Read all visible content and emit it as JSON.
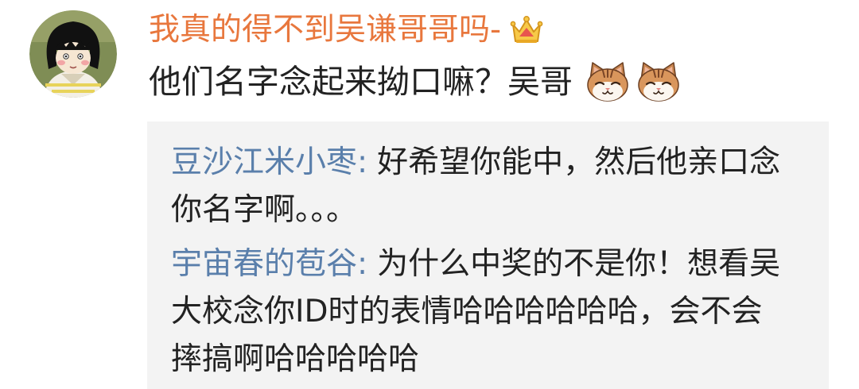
{
  "comment": {
    "avatar_icon": "cartoon-girl-avatar",
    "username": "我真的得不到吴谦哥哥吗-",
    "badge_icon": "crown-icon",
    "text": "他们名字念起来拗口嘛？吴哥",
    "emoji_icons": [
      "cat-face-icon",
      "cat-face-icon"
    ],
    "replies": [
      {
        "name": "豆沙江米小枣:",
        "lines": [
          "好希望你能中，然后他亲口念",
          "你名字啊。。。"
        ]
      },
      {
        "name": "宇宙春的苞谷:",
        "lines": [
          "为什么中奖的不是你！想看吴",
          "大校念你ID时的表情哈哈哈哈哈哈，会不会",
          "摔搞啊哈哈哈哈哈"
        ]
      }
    ]
  },
  "colors": {
    "username": "#e8773d",
    "reply_name": "#5a7fab",
    "text": "#222222",
    "reply_bg": "#f3f3f3"
  }
}
